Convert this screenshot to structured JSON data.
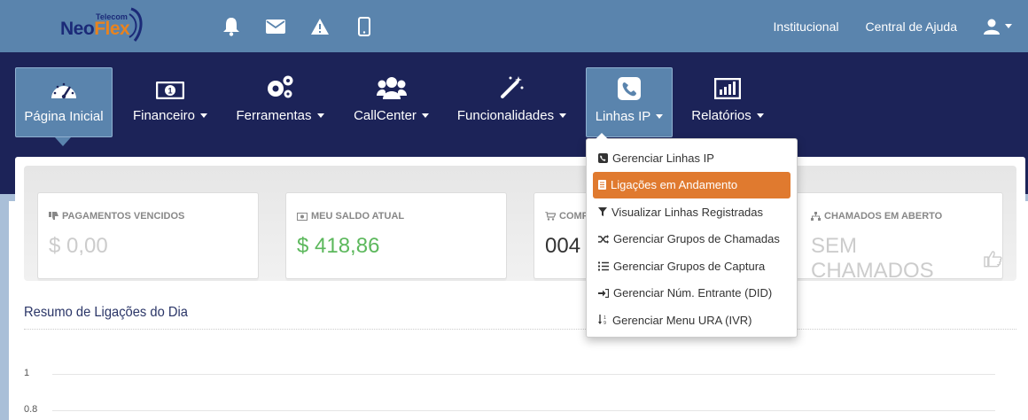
{
  "brand": {
    "logo_text": "NeoFlex",
    "logo_sub": "Telecom"
  },
  "topbar": {
    "icons": [
      "bell-icon",
      "envelope-icon",
      "warning-icon",
      "mobile-icon"
    ],
    "links": [
      {
        "label": "Institucional"
      },
      {
        "label": "Central de Ajuda"
      }
    ],
    "user_icon": "user-icon"
  },
  "nav": {
    "items": [
      {
        "label": "Página Inicial",
        "icon": "dashboard-icon",
        "active": true
      },
      {
        "label": "Financeiro",
        "icon": "money-icon",
        "dropdown": true
      },
      {
        "label": "Ferramentas",
        "icon": "gears-icon",
        "dropdown": true
      },
      {
        "label": "CallCenter",
        "icon": "users-icon",
        "dropdown": true
      },
      {
        "label": "Funcionalidades",
        "icon": "magic-wand-icon",
        "dropdown": true
      },
      {
        "label": "Linhas IP",
        "icon": "phone-icon",
        "dropdown": true,
        "open": true
      },
      {
        "label": "Relatórios",
        "icon": "bar-chart-icon",
        "dropdown": true
      }
    ]
  },
  "dropdown": {
    "items": [
      {
        "label": "Gerenciar Linhas IP",
        "icon": "phone-square-icon"
      },
      {
        "label": "Ligações em Andamento",
        "icon": "list-icon",
        "highlight": true
      },
      {
        "label": "Visualizar Linhas Registradas",
        "icon": "filter-icon"
      },
      {
        "label": "Gerenciar Grupos de Chamadas",
        "icon": "random-icon"
      },
      {
        "label": "Gerenciar Grupos de Captura",
        "icon": "list-ol-icon"
      },
      {
        "label": "Gerenciar Núm. Entrante (DID)",
        "icon": "sign-in-icon"
      },
      {
        "label": "Gerenciar Menu URA (IVR)",
        "icon": "sort-numeric-icon"
      }
    ]
  },
  "cards": [
    {
      "title": "PAGAMENTOS VENCIDOS",
      "value": "$ 0,00",
      "icon": "thumbs-down-icon",
      "color": "#cccccc"
    },
    {
      "title": "MEU SALDO ATUAL",
      "value": "$ 418,86",
      "icon": "money-icon",
      "color": "#5cb85c"
    },
    {
      "title": "COMP",
      "value": "004 0",
      "icon": "cart-icon",
      "color": "#333333"
    },
    {
      "title": "CHAMADOS EM ABERTO",
      "value": "SEM CHAMADOS",
      "icon": "sitemap-icon",
      "color": "#cccccc"
    }
  ],
  "section": {
    "title": "Resumo de Ligações do Dia"
  },
  "chart_axis": {
    "y_ticks": [
      "1",
      "0.8"
    ]
  },
  "colors": {
    "topbar": "#5a84ad",
    "navbar": "#1c2358",
    "accent": "#e07a2f",
    "positive": "#5cb85c"
  }
}
